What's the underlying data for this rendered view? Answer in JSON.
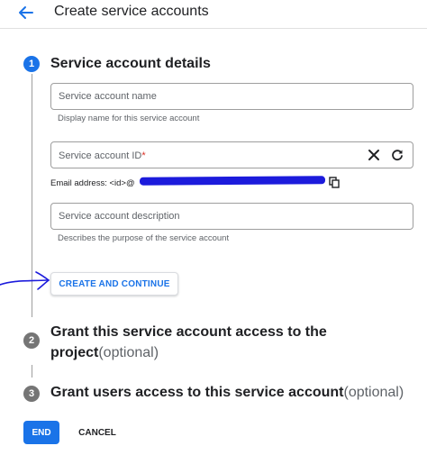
{
  "header": {
    "title": "Create service accounts"
  },
  "steps": [
    {
      "number": "1",
      "title": "Service account details"
    },
    {
      "number": "2",
      "title_line1": "Grant this service account access to the",
      "title_line2": "project",
      "optional": "(optional)"
    },
    {
      "number": "3",
      "title": "Grant users access to this service account",
      "optional": "(optional)"
    }
  ],
  "form": {
    "name_placeholder": "Service account name",
    "name_hint": "Display name for this service account",
    "id_label": "Service account ID",
    "id_required_mark": "*",
    "email_prefix": "Email address: <id>@",
    "description_placeholder": "Service account description",
    "description_hint": "Describes the purpose of the service account"
  },
  "buttons": {
    "create_continue": "CREATE AND CONTINUE",
    "end": "END",
    "cancel": "CANCEL"
  },
  "icons": [
    "back-arrow-icon",
    "clear-icon",
    "refresh-icon",
    "copy-icon"
  ],
  "colors": {
    "accent": "#1a73e8",
    "redaction": "#1c1bdc",
    "required": "#d93025"
  }
}
